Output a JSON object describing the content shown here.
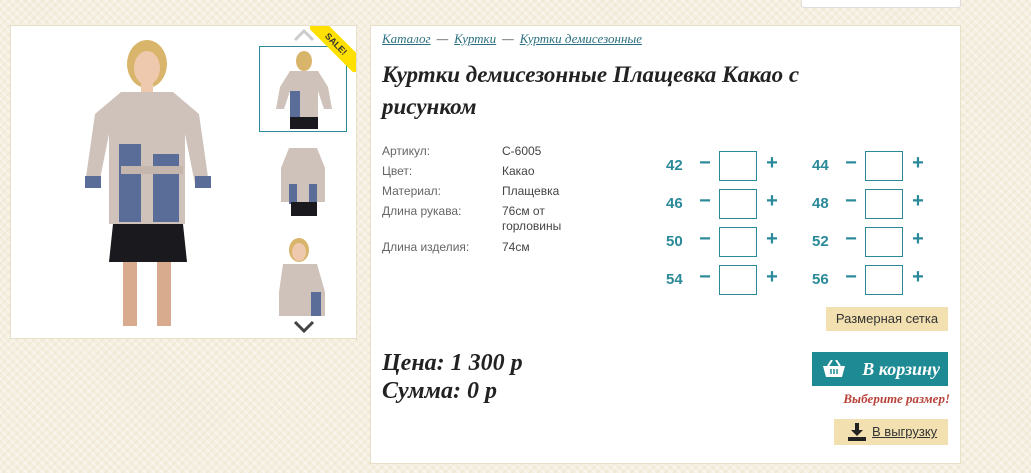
{
  "breadcrumb": {
    "items": [
      "Каталог",
      "Куртки",
      "Куртки демисезонные"
    ],
    "separator": "—"
  },
  "product": {
    "title": "Куртки демисезонные Плащевка Какао с рисунком",
    "sale_badge": "SALE!",
    "properties": [
      {
        "key": "Артикул:",
        "value": "С-6005"
      },
      {
        "key": "Цвет:",
        "value": "Какао"
      },
      {
        "key": "Материал:",
        "value": "Плащевка"
      },
      {
        "key": "Длина рукава:",
        "value": "76см от горловины"
      },
      {
        "key": "Длина изделия:",
        "value": "74см"
      }
    ]
  },
  "sizes": [
    "42",
    "44",
    "46",
    "48",
    "50",
    "52",
    "54",
    "56"
  ],
  "size_controls": {
    "minus": "−",
    "plus": "+"
  },
  "buttons": {
    "size_grid": "Размерная сетка",
    "add_to_cart": "В корзину",
    "export": "В выгрузку"
  },
  "price": {
    "price_line": "Цена: 1 300 р",
    "sum_line": "Сумма: 0 р"
  },
  "messages": {
    "choose_size": "Выберите размер!"
  },
  "icons": {
    "cart": "shopping-basket-icon",
    "export": "download-icon",
    "gallery_up": "chevron-up-icon",
    "gallery_down": "chevron-down-icon"
  },
  "colors": {
    "accent": "#1e8a94",
    "warning": "#b8423a",
    "secondary_button": "#f2e0b0",
    "sale": "#ffe000"
  }
}
